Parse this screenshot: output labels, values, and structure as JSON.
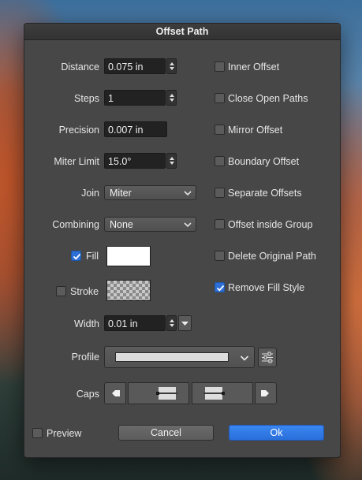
{
  "dialog": {
    "title": "Offset Path",
    "distance": {
      "label": "Distance",
      "value": "0.075 in"
    },
    "steps": {
      "label": "Steps",
      "value": "1"
    },
    "precision": {
      "label": "Precision",
      "value": "0.007 in"
    },
    "miter_limit": {
      "label": "Miter Limit",
      "value": "15.0°"
    },
    "join": {
      "label": "Join",
      "value": "Miter"
    },
    "combining": {
      "label": "Combining",
      "value": "None"
    },
    "fill": {
      "label": "Fill",
      "checked": true,
      "color": "#ffffff"
    },
    "stroke": {
      "label": "Stroke",
      "checked": false
    },
    "width": {
      "label": "Width",
      "value": "0.01 in"
    },
    "profile": {
      "label": "Profile"
    },
    "caps": {
      "label": "Caps"
    },
    "options": [
      {
        "label": "Inner Offset",
        "checked": false
      },
      {
        "label": "Close Open Paths",
        "checked": false
      },
      {
        "label": "Mirror Offset",
        "checked": false
      },
      {
        "label": "Boundary Offset",
        "checked": false
      },
      {
        "label": "Separate Offsets",
        "checked": false
      },
      {
        "label": "Offset inside Group",
        "checked": false
      },
      {
        "label": "Delete Original Path",
        "checked": false
      },
      {
        "label": "Remove Fill Style",
        "checked": true
      }
    ],
    "preview": {
      "label": "Preview",
      "checked": false
    },
    "cancel_label": "Cancel",
    "ok_label": "Ok",
    "accent_color": "#2c6fd6"
  }
}
